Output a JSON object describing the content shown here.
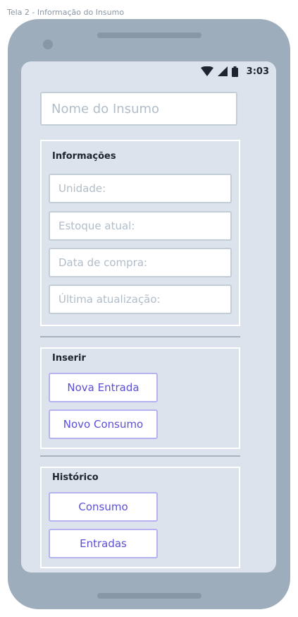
{
  "frame_label": "Tela 2 - Informação do Insumo",
  "status_bar": {
    "time": "3:03",
    "icons": [
      "wifi-icon",
      "signal-icon",
      "battery-icon"
    ]
  },
  "name_field": {
    "placeholder": "Nome do Insumo",
    "value": ""
  },
  "info_section": {
    "title": "Informações",
    "fields": [
      {
        "placeholder": "Unidade:",
        "value": ""
      },
      {
        "placeholder": "Estoque atual:",
        "value": ""
      },
      {
        "placeholder": "Data de compra:",
        "value": ""
      },
      {
        "placeholder": "Última atualização:",
        "value": ""
      }
    ]
  },
  "insert_section": {
    "title": "Inserir",
    "buttons": [
      "Nova Entrada",
      "Novo Consumo"
    ]
  },
  "history_section": {
    "title": "Histórico",
    "buttons": [
      "Consumo",
      "Entradas"
    ]
  },
  "colors": {
    "phone_body": "#9eadbb",
    "screen_background": "#dde3ec",
    "button_text": "#5b4fd6",
    "button_border": "#b6b2f0",
    "field_border": "#c3cdd8",
    "placeholder": "#b1bdc9"
  }
}
